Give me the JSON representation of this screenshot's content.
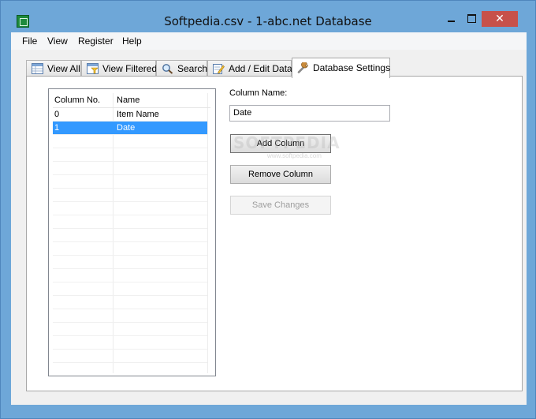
{
  "window": {
    "title": "Softpedia.csv - 1-abc.net Database",
    "close_glyph": "✕"
  },
  "menu": [
    "File",
    "View",
    "Register",
    "Help"
  ],
  "tabs": [
    {
      "label": "View All",
      "icon": "table-icon"
    },
    {
      "label": "View Filtered",
      "icon": "filter-table-icon"
    },
    {
      "label": "Search",
      "icon": "magnifier-icon"
    },
    {
      "label": "Add / Edit Data",
      "icon": "edit-icon"
    },
    {
      "label": "Database Settings",
      "icon": "wrench-icon",
      "active": true
    }
  ],
  "columns_grid": {
    "headers": [
      "Column No.",
      "Name"
    ],
    "rows": [
      {
        "no": "0",
        "name": "Item Name",
        "selected": false
      },
      {
        "no": "1",
        "name": "Date",
        "selected": true
      }
    ]
  },
  "editor": {
    "column_name_label": "Column Name:",
    "column_name_value": "Date",
    "add_button": "Add Column",
    "remove_button": "Remove Column",
    "save_button": "Save Changes",
    "save_enabled": false
  },
  "watermark": {
    "main": "SOFTPEDIA",
    "sub": "www.softpedia.com"
  },
  "colors": {
    "titlebar": "#6ea7d8",
    "close": "#c7514a",
    "selection": "#3399ff"
  }
}
